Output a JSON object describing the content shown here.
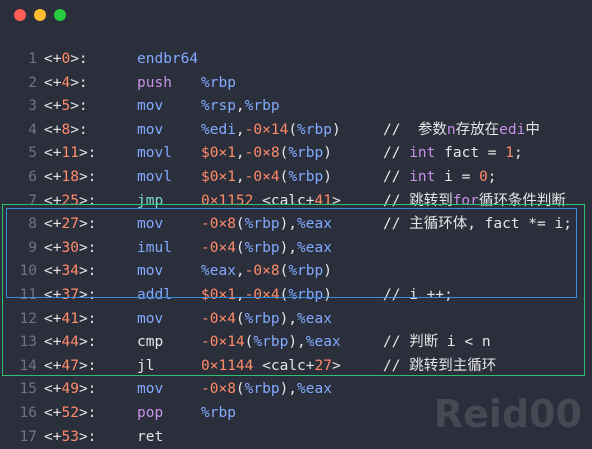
{
  "watermark": "Reid00",
  "colors": {
    "background": "#2b2e3b",
    "green_box": "#2fbf71",
    "blue_box": "#3a8ddb"
  },
  "lines": [
    {
      "ln": "1",
      "off_pre": "<+",
      "off_num": "0",
      "off_post": ">:",
      "mnemonic": "endbr64",
      "ops": [],
      "comment": []
    },
    {
      "ln": "2",
      "off_pre": "<+",
      "off_num": "4",
      "off_post": ">:",
      "mnemonic": "push",
      "ops": [
        [
          "reg",
          "%rbp"
        ]
      ],
      "comment": []
    },
    {
      "ln": "3",
      "off_pre": "<+",
      "off_num": "5",
      "off_post": ">:",
      "mnemonic": "mov",
      "ops": [
        [
          "reg",
          "%rsp"
        ],
        [
          "p",
          ","
        ],
        [
          "reg",
          "%rbp"
        ]
      ],
      "comment": []
    },
    {
      "ln": "4",
      "off_pre": "<+",
      "off_num": "8",
      "off_post": ">:",
      "mnemonic": "mov",
      "ops": [
        [
          "reg",
          "%edi"
        ],
        [
          "p",
          ","
        ],
        [
          "nm",
          "-0×14"
        ],
        [
          "p",
          "("
        ],
        [
          "reg",
          "%rbp"
        ],
        [
          "p",
          ")"
        ]
      ],
      "comment": [
        [
          "p",
          "//  参数"
        ],
        [
          "kw",
          "n"
        ],
        [
          "p",
          "存放在"
        ],
        [
          "kw",
          "edi"
        ],
        [
          "p",
          "中"
        ]
      ]
    },
    {
      "ln": "5",
      "off_pre": "<+",
      "off_num": "11",
      "off_post": ">:",
      "mnemonic": "movl",
      "ops": [
        [
          "nm",
          "$0×1"
        ],
        [
          "p",
          ","
        ],
        [
          "nm",
          "-0×8"
        ],
        [
          "p",
          "("
        ],
        [
          "reg",
          "%rbp"
        ],
        [
          "p",
          ")"
        ]
      ],
      "comment": [
        [
          "p",
          "// "
        ],
        [
          "kw",
          "int"
        ],
        [
          "p",
          " fact = "
        ],
        [
          "nm",
          "1"
        ],
        [
          "p",
          ";"
        ]
      ]
    },
    {
      "ln": "6",
      "off_pre": "<+",
      "off_num": "18",
      "off_post": ">:",
      "mnemonic": "movl",
      "ops": [
        [
          "nm",
          "$0×1"
        ],
        [
          "p",
          ","
        ],
        [
          "nm",
          "-0×4"
        ],
        [
          "p",
          "("
        ],
        [
          "reg",
          "%rbp"
        ],
        [
          "p",
          ")"
        ]
      ],
      "comment": [
        [
          "p",
          "// "
        ],
        [
          "kw",
          "int"
        ],
        [
          "p",
          " i = "
        ],
        [
          "nm",
          "0"
        ],
        [
          "p",
          ";"
        ]
      ]
    },
    {
      "ln": "7",
      "off_pre": "<+",
      "off_num": "25",
      "off_post": ">:",
      "mnemonic": "jmp",
      "ops": [
        [
          "nm",
          "0×1152"
        ],
        [
          "p",
          " <calc+"
        ],
        [
          "nm",
          "41"
        ],
        [
          "p",
          ">"
        ]
      ],
      "comment": [
        [
          "p",
          "// 跳转到"
        ],
        [
          "kw",
          "for"
        ],
        [
          "p",
          "循环条件判断"
        ]
      ]
    },
    {
      "ln": "8",
      "off_pre": "<+",
      "off_num": "27",
      "off_post": ">:",
      "mnemonic": "mov",
      "ops": [
        [
          "nm",
          "-0×8"
        ],
        [
          "p",
          "("
        ],
        [
          "reg",
          "%rbp"
        ],
        [
          "p",
          "),"
        ],
        [
          "reg",
          "%eax"
        ]
      ],
      "comment": [
        [
          "p",
          "// 主循环体, fact *= i;"
        ]
      ]
    },
    {
      "ln": "9",
      "off_pre": "<+",
      "off_num": "30",
      "off_post": ">:",
      "mnemonic": "imul",
      "ops": [
        [
          "nm",
          "-0×4"
        ],
        [
          "p",
          "("
        ],
        [
          "reg",
          "%rbp"
        ],
        [
          "p",
          "),"
        ],
        [
          "reg",
          "%eax"
        ]
      ],
      "comment": []
    },
    {
      "ln": "10",
      "off_pre": "<+",
      "off_num": "34",
      "off_post": ">:",
      "mnemonic": "mov",
      "ops": [
        [
          "reg",
          "%eax"
        ],
        [
          "p",
          ","
        ],
        [
          "nm",
          "-0×8"
        ],
        [
          "p",
          "("
        ],
        [
          "reg",
          "%rbp"
        ],
        [
          "p",
          ")"
        ]
      ],
      "comment": []
    },
    {
      "ln": "11",
      "off_pre": "<+",
      "off_num": "37",
      "off_post": ">:",
      "mnemonic": "addl",
      "ops": [
        [
          "nm",
          "$0×1"
        ],
        [
          "p",
          ","
        ],
        [
          "nm",
          "-0×4"
        ],
        [
          "p",
          "("
        ],
        [
          "reg",
          "%rbp"
        ],
        [
          "p",
          ")"
        ]
      ],
      "comment": [
        [
          "p",
          "// i ++;"
        ]
      ]
    },
    {
      "ln": "12",
      "off_pre": "<+",
      "off_num": "41",
      "off_post": ">:",
      "mnemonic": "mov",
      "ops": [
        [
          "nm",
          "-0×4"
        ],
        [
          "p",
          "("
        ],
        [
          "reg",
          "%rbp"
        ],
        [
          "p",
          "),"
        ],
        [
          "reg",
          "%eax"
        ]
      ],
      "comment": []
    },
    {
      "ln": "13",
      "off_pre": "<+",
      "off_num": "44",
      "off_post": ">:",
      "mnemonic": "cmp",
      "ops": [
        [
          "nm",
          "-0×14"
        ],
        [
          "p",
          "("
        ],
        [
          "reg",
          "%rbp"
        ],
        [
          "p",
          "),"
        ],
        [
          "reg",
          "%eax"
        ]
      ],
      "comment": [
        [
          "p",
          "// 判断 i < n"
        ]
      ]
    },
    {
      "ln": "14",
      "off_pre": "<+",
      "off_num": "47",
      "off_post": ">:",
      "mnemonic": "jl",
      "ops": [
        [
          "nm",
          "0×1144"
        ],
        [
          "p",
          " <calc+"
        ],
        [
          "nm",
          "27"
        ],
        [
          "p",
          ">"
        ]
      ],
      "comment": [
        [
          "p",
          "// 跳转到主循环"
        ]
      ]
    },
    {
      "ln": "15",
      "off_pre": "<+",
      "off_num": "49",
      "off_post": ">:",
      "mnemonic": "mov",
      "ops": [
        [
          "nm",
          "-0×8"
        ],
        [
          "p",
          "("
        ],
        [
          "reg",
          "%rbp"
        ],
        [
          "p",
          "),"
        ],
        [
          "reg",
          "%eax"
        ]
      ],
      "comment": []
    },
    {
      "ln": "16",
      "off_pre": "<+",
      "off_num": "52",
      "off_post": ">:",
      "mnemonic": "pop",
      "ops": [
        [
          "reg",
          "%rbp"
        ]
      ],
      "comment": []
    },
    {
      "ln": "17",
      "off_pre": "<+",
      "off_num": "53",
      "off_post": ">:",
      "mnemonic": "ret",
      "ops": [],
      "comment": []
    }
  ]
}
